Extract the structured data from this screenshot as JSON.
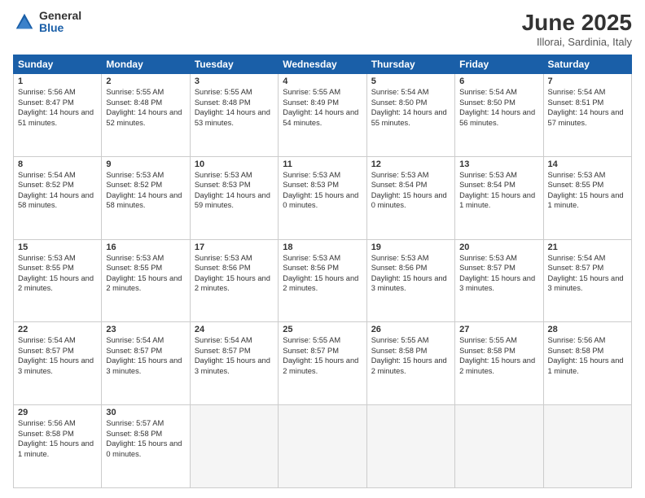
{
  "header": {
    "logo_general": "General",
    "logo_blue": "Blue",
    "month_title": "June 2025",
    "location": "Illorai, Sardinia, Italy"
  },
  "calendar": {
    "days_of_week": [
      "Sunday",
      "Monday",
      "Tuesday",
      "Wednesday",
      "Thursday",
      "Friday",
      "Saturday"
    ],
    "weeks": [
      [
        {
          "day": "",
          "info": ""
        },
        {
          "day": "2",
          "info": "Sunrise: 5:55 AM\nSunset: 8:48 PM\nDaylight: 14 hours\nand 52 minutes."
        },
        {
          "day": "3",
          "info": "Sunrise: 5:55 AM\nSunset: 8:48 PM\nDaylight: 14 hours\nand 53 minutes."
        },
        {
          "day": "4",
          "info": "Sunrise: 5:55 AM\nSunset: 8:49 PM\nDaylight: 14 hours\nand 54 minutes."
        },
        {
          "day": "5",
          "info": "Sunrise: 5:54 AM\nSunset: 8:50 PM\nDaylight: 14 hours\nand 55 minutes."
        },
        {
          "day": "6",
          "info": "Sunrise: 5:54 AM\nSunset: 8:50 PM\nDaylight: 14 hours\nand 56 minutes."
        },
        {
          "day": "7",
          "info": "Sunrise: 5:54 AM\nSunset: 8:51 PM\nDaylight: 14 hours\nand 57 minutes."
        }
      ],
      [
        {
          "day": "1",
          "info": "Sunrise: 5:56 AM\nSunset: 8:47 PM\nDaylight: 14 hours\nand 51 minutes.",
          "first": true
        },
        {
          "day": "9",
          "info": "Sunrise: 5:53 AM\nSunset: 8:52 PM\nDaylight: 14 hours\nand 58 minutes."
        },
        {
          "day": "10",
          "info": "Sunrise: 5:53 AM\nSunset: 8:53 PM\nDaylight: 14 hours\nand 59 minutes."
        },
        {
          "day": "11",
          "info": "Sunrise: 5:53 AM\nSunset: 8:53 PM\nDaylight: 15 hours\nand 0 minutes."
        },
        {
          "day": "12",
          "info": "Sunrise: 5:53 AM\nSunset: 8:54 PM\nDaylight: 15 hours\nand 0 minutes."
        },
        {
          "day": "13",
          "info": "Sunrise: 5:53 AM\nSunset: 8:54 PM\nDaylight: 15 hours\nand 1 minute."
        },
        {
          "day": "14",
          "info": "Sunrise: 5:53 AM\nSunset: 8:55 PM\nDaylight: 15 hours\nand 1 minute."
        }
      ],
      [
        {
          "day": "8",
          "info": "Sunrise: 5:54 AM\nSunset: 8:52 PM\nDaylight: 14 hours\nand 58 minutes.",
          "first": true
        },
        {
          "day": "16",
          "info": "Sunrise: 5:53 AM\nSunset: 8:55 PM\nDaylight: 15 hours\nand 2 minutes."
        },
        {
          "day": "17",
          "info": "Sunrise: 5:53 AM\nSunset: 8:56 PM\nDaylight: 15 hours\nand 2 minutes."
        },
        {
          "day": "18",
          "info": "Sunrise: 5:53 AM\nSunset: 8:56 PM\nDaylight: 15 hours\nand 2 minutes."
        },
        {
          "day": "19",
          "info": "Sunrise: 5:53 AM\nSunset: 8:56 PM\nDaylight: 15 hours\nand 3 minutes."
        },
        {
          "day": "20",
          "info": "Sunrise: 5:53 AM\nSunset: 8:57 PM\nDaylight: 15 hours\nand 3 minutes."
        },
        {
          "day": "21",
          "info": "Sunrise: 5:54 AM\nSunset: 8:57 PM\nDaylight: 15 hours\nand 3 minutes."
        }
      ],
      [
        {
          "day": "15",
          "info": "Sunrise: 5:53 AM\nSunset: 8:55 PM\nDaylight: 15 hours\nand 2 minutes.",
          "first": true
        },
        {
          "day": "23",
          "info": "Sunrise: 5:54 AM\nSunset: 8:57 PM\nDaylight: 15 hours\nand 3 minutes."
        },
        {
          "day": "24",
          "info": "Sunrise: 5:54 AM\nSunset: 8:57 PM\nDaylight: 15 hours\nand 3 minutes."
        },
        {
          "day": "25",
          "info": "Sunrise: 5:55 AM\nSunset: 8:57 PM\nDaylight: 15 hours\nand 2 minutes."
        },
        {
          "day": "26",
          "info": "Sunrise: 5:55 AM\nSunset: 8:58 PM\nDaylight: 15 hours\nand 2 minutes."
        },
        {
          "day": "27",
          "info": "Sunrise: 5:55 AM\nSunset: 8:58 PM\nDaylight: 15 hours\nand 2 minutes."
        },
        {
          "day": "28",
          "info": "Sunrise: 5:56 AM\nSunset: 8:58 PM\nDaylight: 15 hours\nand 1 minute."
        }
      ],
      [
        {
          "day": "22",
          "info": "Sunrise: 5:54 AM\nSunset: 8:57 PM\nDaylight: 15 hours\nand 3 minutes.",
          "first": true
        },
        {
          "day": "30",
          "info": "Sunrise: 5:57 AM\nSunset: 8:58 PM\nDaylight: 15 hours\nand 0 minutes."
        },
        {
          "day": "",
          "info": ""
        },
        {
          "day": "",
          "info": ""
        },
        {
          "day": "",
          "info": ""
        },
        {
          "day": "",
          "info": ""
        },
        {
          "day": "",
          "info": ""
        }
      ],
      [
        {
          "day": "29",
          "info": "Sunrise: 5:56 AM\nSunset: 8:58 PM\nDaylight: 15 hours\nand 1 minute.",
          "first": true
        }
      ]
    ]
  }
}
